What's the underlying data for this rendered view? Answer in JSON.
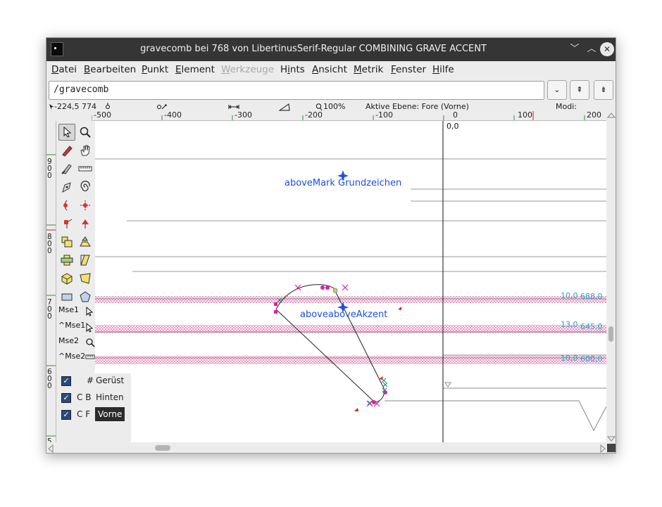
{
  "window": {
    "title": "gravecomb bei 768 von LibertinusSerif-Regular COMBINING GRAVE ACCENT",
    "minimize_icon": "chevron-down-icon",
    "maximize_icon": "chevron-up-icon",
    "close_icon": "close-icon",
    "minimize_glyph": "﹀",
    "maximize_glyph": "︿",
    "close_glyph": "✕"
  },
  "menu": [
    {
      "label": "Datei",
      "mnemonic": "D",
      "rest": "atei"
    },
    {
      "label": "Bearbeiten",
      "mnemonic": "B",
      "rest": "earbeiten"
    },
    {
      "label": "Punkt",
      "mnemonic": "P",
      "rest": "unkt"
    },
    {
      "label": "Element",
      "mnemonic": "E",
      "rest": "lement"
    },
    {
      "label": "Werkzeuge",
      "mnemonic": "W",
      "rest": "erkzeuge",
      "disabled": true
    },
    {
      "label": "Hints",
      "mnemonic": "i",
      "pre": "H",
      "rest": "nts"
    },
    {
      "label": "Ansicht",
      "mnemonic": "A",
      "rest": "nsicht"
    },
    {
      "label": "Metrik",
      "mnemonic": "M",
      "rest": "etrik"
    },
    {
      "label": "Fenster",
      "mnemonic": "F",
      "rest": "enster"
    },
    {
      "label": "Hilfe",
      "mnemonic": "H",
      "rest": "ilfe"
    }
  ],
  "glyph_input": {
    "value": "/gravecomb"
  },
  "input_buttons": {
    "dropdown": "⌄",
    "prev": "⇞",
    "next": "⇟",
    "dropdown_icon": "chevron-down-icon",
    "prev_icon": "arrow-up-icon",
    "next_icon": "arrow-down-icon"
  },
  "status": {
    "coords": "-224,5 774",
    "zoom": "100%",
    "layer_info": "Aktive Ebene: Fore (Vorne)",
    "modes": "Modi:"
  },
  "hruler_ticks": [
    "-500",
    "-400",
    "-300",
    "-200",
    "-100",
    "0",
    "100",
    "200"
  ],
  "vruler_labels": [
    [
      "9",
      "0",
      "0"
    ],
    [
      "8",
      "0",
      "0"
    ],
    [
      "7",
      "0",
      "0"
    ],
    [
      "6",
      "0",
      "0"
    ],
    [
      "5"
    ]
  ],
  "canvas": {
    "origin_label": "0,0",
    "anchors": [
      {
        "label": "aboveMark Grundzeichen"
      },
      {
        "label": "aboveaboveAkzent"
      }
    ],
    "guide_labels": [
      {
        "left": "10,0",
        "right": "688,0"
      },
      {
        "left": "13,0",
        "right": "645,0"
      },
      {
        "left": "10,0",
        "right": "600,0"
      }
    ],
    "colors": {
      "anchor": "#1d4fe0",
      "point": "#e0209a",
      "guide_text": "#2aa1c8",
      "hatch": "#e47ab0",
      "outline": "#222222"
    }
  },
  "tools": {
    "mouse_labels": [
      "Mse1",
      "^Mse1",
      "Mse2",
      "^Mse2"
    ]
  },
  "layers": [
    {
      "flags": "#",
      "name": "Gerüst",
      "checked": true,
      "check": "✓"
    },
    {
      "flags": "C B",
      "name": "Hinten",
      "checked": true,
      "check": "✓"
    },
    {
      "flags": "C F",
      "name": "Vorne",
      "checked": true,
      "check": "✓",
      "active": true
    }
  ],
  "layer_buttons": {
    "remove": "−",
    "add": "+"
  }
}
